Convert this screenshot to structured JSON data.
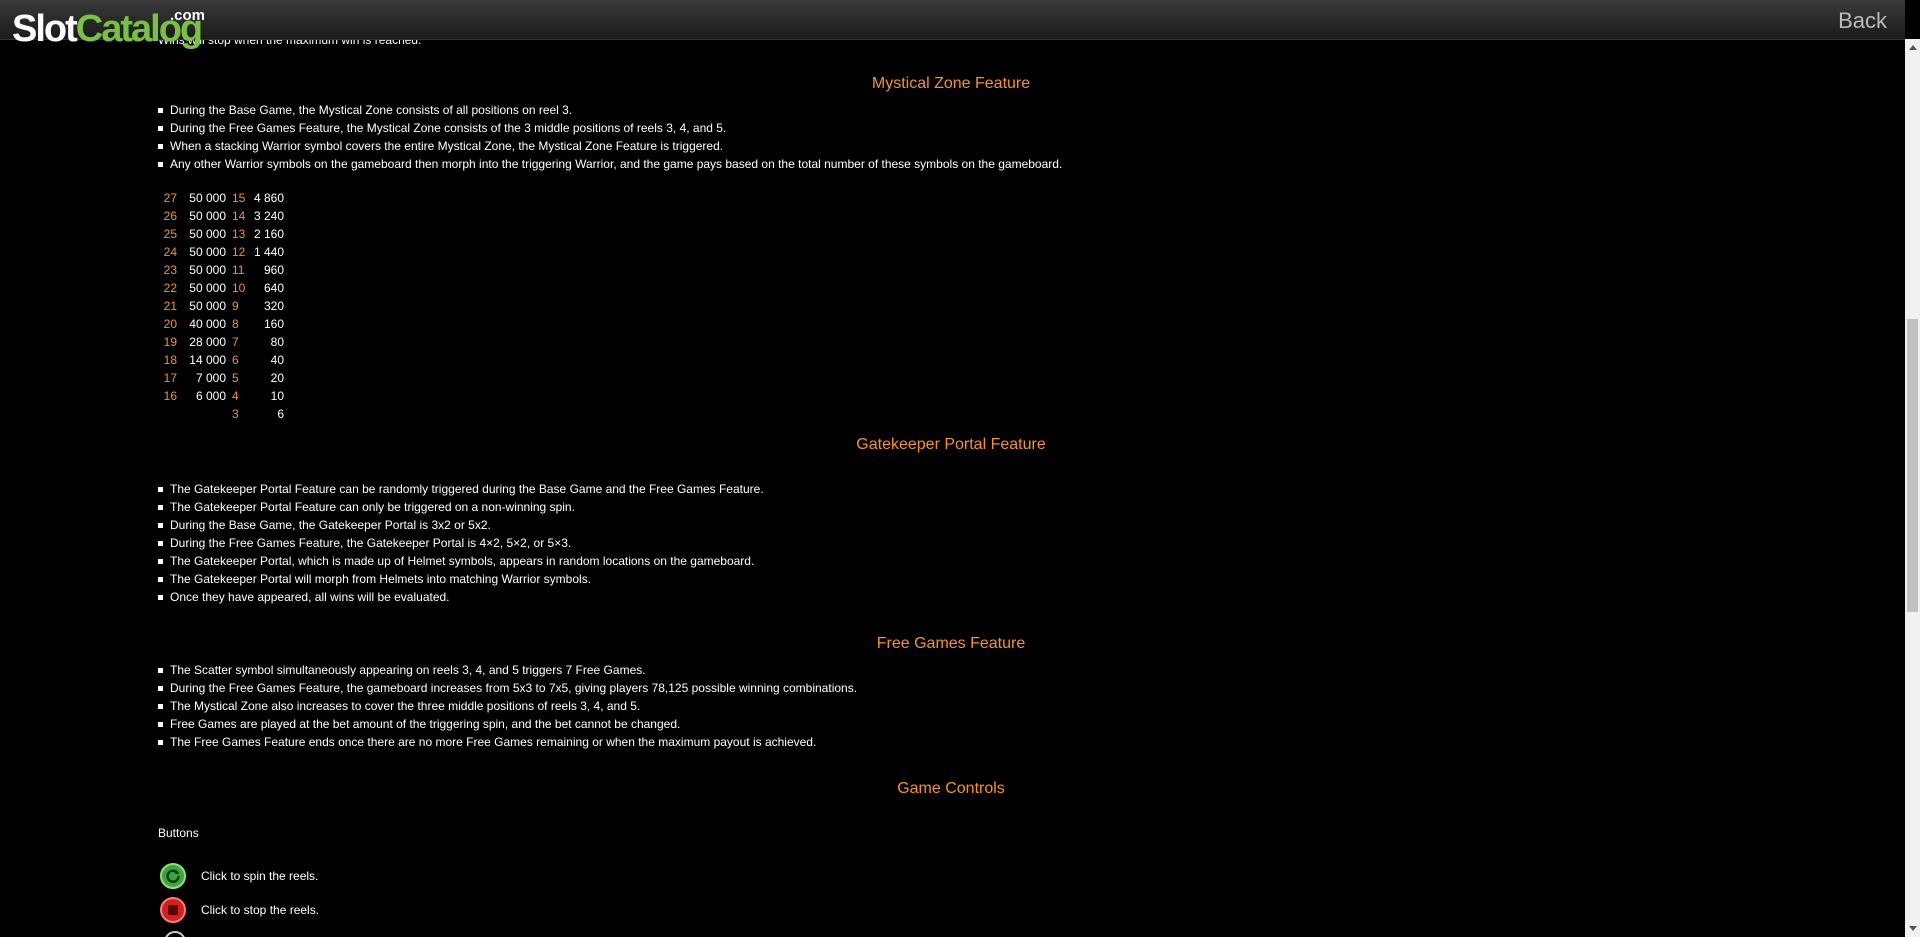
{
  "header": {
    "logo_slot": "Slot",
    "logo_catalog": "Catalog",
    "logo_com": ".com",
    "back_label": "Back"
  },
  "cut_line": "Wins will stop when the maximum win is reached.",
  "sections": {
    "mystical": {
      "title": "Mystical Zone Feature",
      "items": [
        "During the Base Game, the Mystical Zone consists of all positions on reel 3.",
        "During the Free Games Feature, the Mystical Zone consists of the 3 middle positions of reels 3, 4, and 5.",
        "When a stacking Warrior symbol covers the entire Mystical Zone, the Mystical Zone Feature is triggered.",
        "Any other Warrior symbols on the gameboard then morph into the triggering Warrior, and the game pays based on the total number of these symbols on the gameboard."
      ],
      "paytable": [
        [
          "27",
          "50 000",
          "15",
          "4 860"
        ],
        [
          "26",
          "50 000",
          "14",
          "3 240"
        ],
        [
          "25",
          "50 000",
          "13",
          "2 160"
        ],
        [
          "24",
          "50 000",
          "12",
          "1 440"
        ],
        [
          "23",
          "50 000",
          "11",
          "960"
        ],
        [
          "22",
          "50 000",
          "10",
          "640"
        ],
        [
          "21",
          "50 000",
          "9",
          "320"
        ],
        [
          "20",
          "40 000",
          "8",
          "160"
        ],
        [
          "19",
          "28 000",
          "7",
          "80"
        ],
        [
          "18",
          "14 000",
          "6",
          "40"
        ],
        [
          "17",
          "7 000",
          "5",
          "20"
        ],
        [
          "16",
          "6 000",
          "4",
          "10"
        ],
        [
          "",
          "",
          "3",
          "6"
        ]
      ]
    },
    "gatekeeper": {
      "title": "Gatekeeper Portal Feature",
      "items": [
        "The Gatekeeper Portal Feature can be randomly triggered during the Base Game and the Free Games Feature.",
        "The Gatekeeper Portal Feature can only be triggered on a non-winning spin.",
        "During the Base Game, the Gatekeeper Portal is 3x2 or 5x2.",
        "During the Free Games Feature, the Gatekeeper Portal is 4×2, 5×2, or 5×3.",
        "The Gatekeeper Portal, which is made up of Helmet symbols, appears in random locations on the gameboard.",
        "The Gatekeeper Portal will morph from Helmets into matching Warrior symbols.",
        "Once they have appeared, all wins will be evaluated."
      ]
    },
    "freegames": {
      "title": "Free Games Feature",
      "items": [
        "The Scatter symbol simultaneously appearing on reels 3, 4, and 5 triggers 7 Free Games.",
        "During the Free Games Feature, the gameboard increases from 5x3 to 7x5, giving players 78,125 possible winning combinations.",
        "The Mystical Zone also increases to cover the three middle positions of reels 3, 4, and 5.",
        "Free Games are played at the bet amount of the triggering spin, and the bet cannot be changed.",
        "The Free Games Feature ends once there are no more Free Games remaining or when the maximum payout is achieved."
      ]
    },
    "controls": {
      "title": "Game Controls",
      "buttons_label": "Buttons",
      "spin_text": "Click to spin the reels.",
      "stop_text": "Click to stop the reels."
    }
  },
  "colors": {
    "accent": "#f7941d",
    "logo_green": "#79c142",
    "spin_green": "#3da63a",
    "stop_red": "#d21f1f"
  }
}
